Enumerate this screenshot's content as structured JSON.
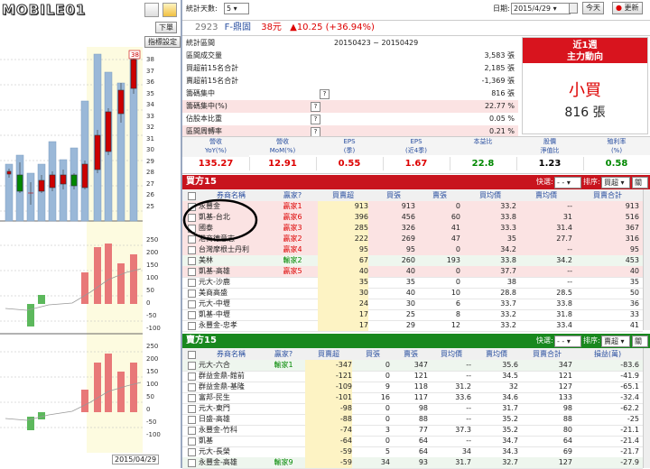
{
  "left_pane": {
    "logo_text": "MOBILE01",
    "buy_button": "下單",
    "indicator_button": "指標設定",
    "price_axis": [
      "38",
      "37",
      "36",
      "35",
      "34",
      "33",
      "32",
      "31",
      "30",
      "29",
      "28",
      "27",
      "26",
      "25"
    ],
    "vol_axis": [
      "250",
      "200",
      "150",
      "100",
      "50",
      "0",
      "-50",
      "-100"
    ],
    "vol_axis2": [
      "250",
      "200",
      "150",
      "100",
      "50",
      "0",
      "-50",
      "-100"
    ],
    "price_box": "38",
    "date_label": "2015/04/29"
  },
  "toolbar": {
    "days_label": "統計天數:",
    "days_value": "5",
    "date_label": "日期:",
    "date_value": "2015/4/29",
    "today_button": "今天",
    "refresh_button": "更新"
  },
  "stock": {
    "code": "2923",
    "name": "F-鼎固",
    "price": "38元",
    "change": "▲10.25 (+36.94%)"
  },
  "stats": [
    {
      "label": "統計區間",
      "value": "20150423 ~ 20150429",
      "help": false
    },
    {
      "label": "區間成交量",
      "value": "3,583 張",
      "help": false
    },
    {
      "label": "買超前15名合計",
      "value": "2,185 張",
      "help": false
    },
    {
      "label": "賣超前15名合計",
      "value": "-1,369 張",
      "help": false
    },
    {
      "label": "籌碼集中",
      "value": "816 張",
      "help": true
    },
    {
      "label": "籌碼集中(%)",
      "value": "22.77 %",
      "help": true
    },
    {
      "label": "佔股本比重",
      "value": "0.05 %",
      "help": true
    },
    {
      "label": "區間周轉率",
      "value": "0.21 %",
      "help": true
    }
  ],
  "trend": {
    "title": "近1週",
    "subtitle": "主力動向",
    "verdict": "小買",
    "amount": "816 張"
  },
  "metrics": {
    "headers": [
      "營收\nYoY(%)",
      "營收\nMoM(%)",
      "EPS\n(季)",
      "EPS\n(近4季)",
      "本益比",
      "股價\n淨值比",
      "殖利率\n(%)"
    ],
    "values": [
      "135.27",
      "12.91",
      "0.55",
      "1.67",
      "22.8",
      "1.23",
      "0.58"
    ],
    "colors": [
      "#d00",
      "#d00",
      "#d00",
      "#d00",
      "#080",
      "#000",
      "#080"
    ]
  },
  "buy_section": {
    "title": "買方15",
    "mode_label": "快選:",
    "mode_value": "- -",
    "sort_label": "排序:",
    "sort_value": "買超",
    "sort_btn": "▾",
    "close_btn": "關",
    "headers": [
      "券商名稱",
      "贏家?",
      "買賣超",
      "買張",
      "賣張",
      "買均價",
      "賣均價",
      "買賣合計"
    ],
    "rows": [
      [
        "永豐金",
        "贏家1",
        "913",
        "913",
        "0",
        "33.2",
        "--",
        "913"
      ],
      [
        "凱基-台北",
        "贏家6",
        "396",
        "456",
        "60",
        "33.8",
        "31",
        "516"
      ],
      [
        "國泰",
        "贏家3",
        "285",
        "326",
        "41",
        "33.3",
        "31.4",
        "367"
      ],
      [
        "港商德意志",
        "贏家2",
        "222",
        "269",
        "47",
        "35",
        "27.7",
        "316"
      ],
      [
        "台灣摩根士丹利",
        "贏家4",
        "95",
        "95",
        "0",
        "34.2",
        "--",
        "95"
      ],
      [
        "美林",
        "輸家2",
        "67",
        "260",
        "193",
        "33.8",
        "34.2",
        "453"
      ],
      [
        "凱基-高雄",
        "贏家5",
        "40",
        "40",
        "0",
        "37.7",
        "--",
        "40"
      ],
      [
        "元大-沙鹿",
        "",
        "35",
        "35",
        "0",
        "38",
        "--",
        "35"
      ],
      [
        "美商高盛",
        "",
        "30",
        "40",
        "10",
        "28.8",
        "28.5",
        "50"
      ],
      [
        "元大-中壢",
        "",
        "24",
        "30",
        "6",
        "33.7",
        "33.8",
        "36"
      ],
      [
        "凱基-中壢",
        "",
        "17",
        "25",
        "8",
        "33.2",
        "31.8",
        "33"
      ],
      [
        "永豐金-忠孝",
        "",
        "17",
        "29",
        "12",
        "33.2",
        "33.4",
        "41"
      ]
    ]
  },
  "sell_section": {
    "title": "賣方15",
    "mode_label": "快選:",
    "mode_value": "- -",
    "sort_label": "排序:",
    "sort_value": "賣超",
    "sort_btn": "▾",
    "close_btn": "關",
    "headers": [
      "券商名稱",
      "贏家?",
      "買賣超",
      "買張",
      "賣張",
      "買均價",
      "賣均價",
      "買賣合計",
      "損益(萬)"
    ],
    "rows": [
      [
        "元大-六合",
        "輸家1",
        "-347",
        "0",
        "347",
        "--",
        "35.6",
        "347",
        "-83.6"
      ],
      [
        "群益金鼎-館前",
        "",
        "-121",
        "0",
        "121",
        "--",
        "34.5",
        "121",
        "-41.9"
      ],
      [
        "群益金鼎-基隆",
        "",
        "-109",
        "9",
        "118",
        "31.2",
        "32",
        "127",
        "-65.1"
      ],
      [
        "富邦-民生",
        "",
        "-101",
        "16",
        "117",
        "33.6",
        "34.6",
        "133",
        "-32.4"
      ],
      [
        "元大-東門",
        "",
        "-98",
        "0",
        "98",
        "--",
        "31.7",
        "98",
        "-62.2"
      ],
      [
        "日盛-高雄",
        "",
        "-88",
        "0",
        "88",
        "--",
        "35.2",
        "88",
        "-25"
      ],
      [
        "永豐金-竹科",
        "",
        "-74",
        "3",
        "77",
        "37.3",
        "35.2",
        "80",
        "-21.1"
      ],
      [
        "凱基",
        "",
        "-64",
        "0",
        "64",
        "--",
        "34.7",
        "64",
        "-21.4"
      ],
      [
        "元大-長榮",
        "",
        "-59",
        "5",
        "64",
        "34",
        "34.3",
        "69",
        "-21.7"
      ],
      [
        "永豐金-高雄",
        "輸家9",
        "-59",
        "34",
        "93",
        "31.7",
        "32.7",
        "127",
        "-27.9"
      ]
    ]
  }
}
